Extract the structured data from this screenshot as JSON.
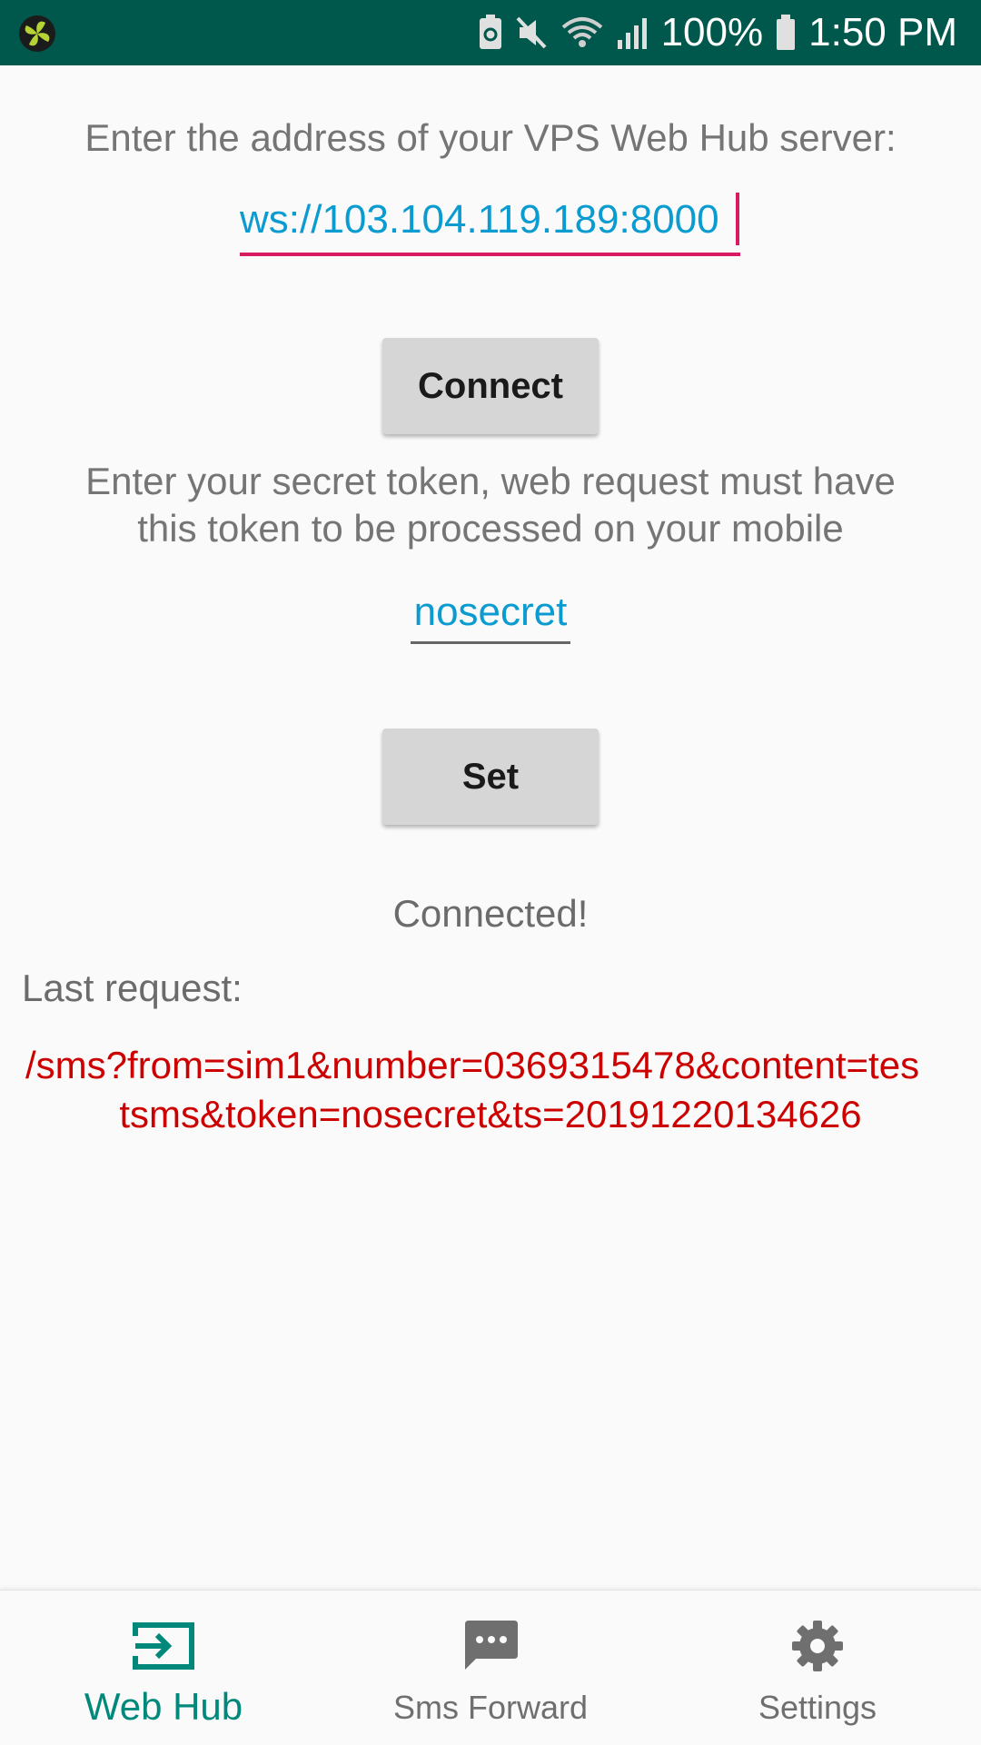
{
  "status_bar": {
    "battery_percent": "100%",
    "time": "1:50 PM",
    "icons": [
      "app-fan-icon",
      "battery-saver-icon",
      "mute-icon",
      "wifi-icon",
      "signal-icon",
      "battery-icon"
    ]
  },
  "server": {
    "label": "Enter the address of your VPS Web Hub server:",
    "value": "ws://103.104.119.189:8000",
    "connect_button": "Connect"
  },
  "token": {
    "label_line1": "Enter your secret token, web request must have",
    "label_line2": "this token to be processed on your mobile",
    "value": "nosecret",
    "set_button": "Set"
  },
  "connection_status": "Connected!",
  "last_request": {
    "label": "Last request:",
    "line1": "/sms?from=sim1&number=0369315478&content=tes",
    "line2": "tsms&token=nosecret&ts=20191220134626"
  },
  "bottom_nav": {
    "items": [
      {
        "label": "Web Hub",
        "icon": "input-icon",
        "active": true
      },
      {
        "label": "Sms Forward",
        "icon": "message-icon",
        "active": false
      },
      {
        "label": "Settings",
        "icon": "gear-icon",
        "active": false
      }
    ]
  },
  "colors": {
    "status_bar": "#00574b",
    "accent": "#00897b",
    "input_text": "#0a9bd0",
    "focus_underline": "#d81b60",
    "request_text": "#cc0000"
  }
}
